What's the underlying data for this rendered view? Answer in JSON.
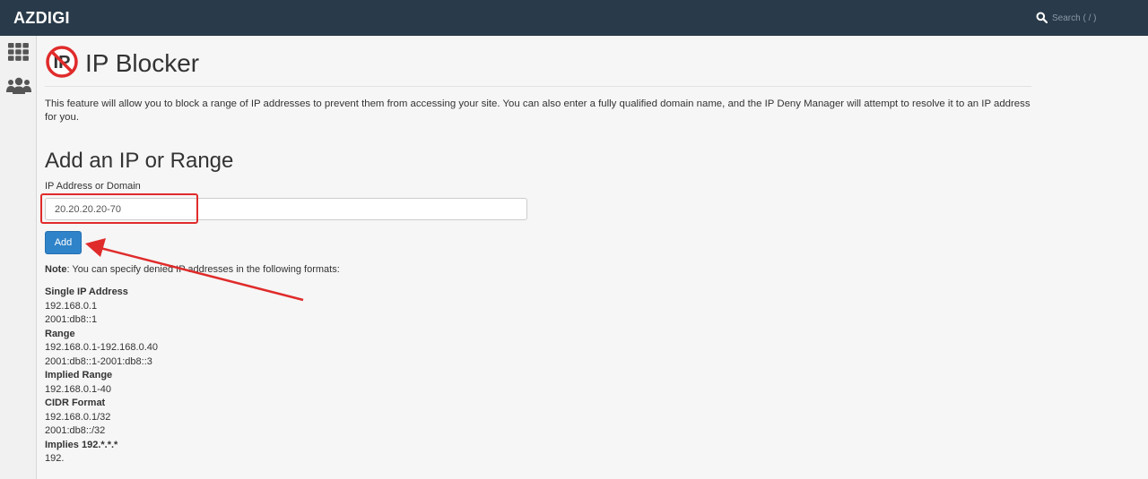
{
  "header": {
    "brand": "AZDIGI",
    "search_placeholder": "Search ( / )"
  },
  "sidebar": {
    "items": [
      {
        "icon": "grid-icon"
      },
      {
        "icon": "users-icon"
      }
    ]
  },
  "page": {
    "title": "IP Blocker",
    "description": "This feature will allow you to block a range of IP addresses to prevent them from accessing your site. You can also enter a fully qualified domain name, and the IP Deny Manager will attempt to resolve it to an IP address for you.",
    "section_title": "Add an IP or Range",
    "field_label": "IP Address or Domain",
    "ip_value": "20.20.20.20-70",
    "add_label": "Add",
    "note_label": "Note",
    "note_text": ": You can specify denied IP addresses in the following formats:"
  },
  "formats": [
    {
      "heading": "Single IP Address",
      "examples": [
        "192.168.0.1",
        "2001:db8::1"
      ]
    },
    {
      "heading": "Range",
      "examples": [
        "192.168.0.1-192.168.0.40",
        "2001:db8::1-2001:db8::3"
      ]
    },
    {
      "heading": "Implied Range",
      "examples": [
        "192.168.0.1-40"
      ]
    },
    {
      "heading": "CIDR Format",
      "examples": [
        "192.168.0.1/32",
        "2001:db8::/32"
      ]
    },
    {
      "heading": "Implies 192.*.*.*",
      "examples": [
        "192."
      ]
    }
  ],
  "colors": {
    "topbar": "#293a4a",
    "button": "#2f83c9",
    "annotation": "#e02b2b"
  }
}
